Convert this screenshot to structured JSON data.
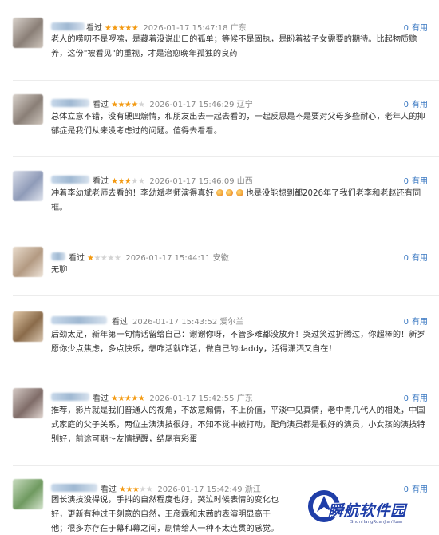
{
  "reviews": [
    {
      "status": "看过",
      "stars": 5,
      "time": "2026-01-17 15:47:18",
      "location": "广东",
      "useful_count": "0",
      "useful_label": "有用",
      "content": "老人的唠叨不是啰嗦，是藏着没说出口的孤单；等候不是固执，是盼着被子女需要的期待。比起物质赡养，这份\"被看见\"的重视，才是治愈晚年孤独的良药"
    },
    {
      "status": "看过",
      "stars": 4,
      "time": "2026-01-17 15:46:29",
      "location": "辽宁",
      "useful_count": "0",
      "useful_label": "有用",
      "content": "总体立意不错，没有硬凹煽情，和朋友出去一起去看的，一起反思是不是要对父母多些耐心，老年人的抑郁症是我们从来没考虑过的问题。值得去看看。"
    },
    {
      "status": "看过",
      "stars": 3,
      "time": "2026-01-17 15:46:09",
      "location": "山西",
      "useful_count": "0",
      "useful_label": "有用",
      "content_a": "冲着李幼斌老师去看的！李幼斌老师演得真好",
      "content_b": "也是没能想到都2026年了我们老李和老赵还有同框。"
    },
    {
      "status": "看过",
      "stars": 1,
      "time": "2026-01-17 15:44:11",
      "location": "安徽",
      "useful_count": "0",
      "useful_label": "有用",
      "content": "无聊"
    },
    {
      "status": "看过",
      "stars": 0,
      "time": "2026-01-17 15:43:52",
      "location": "爱尔兰",
      "useful_count": "0",
      "useful_label": "有用",
      "content": "后劲太足，新年第一句情话留给自己：谢谢你呀，不管多难都没放弃！哭过笑过折腾过，你超棒的！新岁愿你少点焦虑，多点快乐，想咋活就咋活，做自己的daddy，活得潇洒又自在！"
    },
    {
      "status": "看过",
      "stars": 5,
      "time": "2026-01-17 15:42:55",
      "location": "广东",
      "useful_count": "0",
      "useful_label": "有用",
      "content": "推荐，影片就是我们普通人的视角，不故意煽情，不上价值，平淡中见真情，老中青几代人的相处，中国式家庭的父子关系，两位主演演技很好，不知不觉中被打动，配角演员都是很好的演员，小女孩的演技特别好，前途可期～友情提醒，结尾有彩蛋"
    },
    {
      "status": "看过",
      "stars": 3,
      "time": "2026-01-17 15:42:49",
      "location": "浙江",
      "useful_count": "0",
      "useful_label": "有用",
      "content": "团长演技没得说，手抖的自然程度也好，哭泣时候表情的变化也好，更新有种过于刻意的自然，王彦霖和末茜的表演明显高于他；很多亦存在于幕和幕之间，剧情给人一种不太连贯的感觉。"
    }
  ],
  "watermark": {
    "title": "瞬航软件园",
    "subtitle": "ShunHangRuanJianYuan"
  }
}
